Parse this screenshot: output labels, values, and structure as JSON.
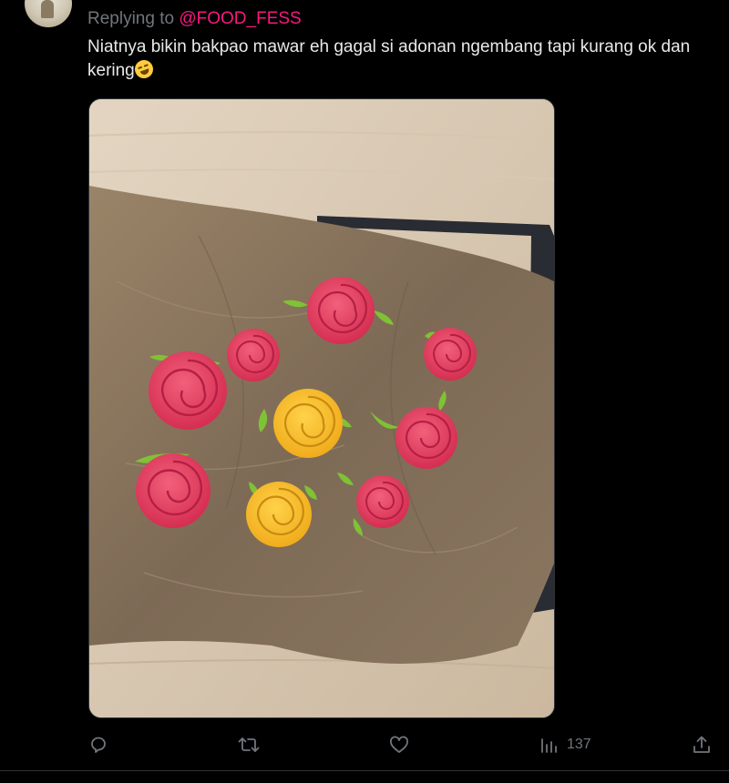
{
  "reply": {
    "prefix": "Replying to ",
    "handle": "@FOOD_FESS"
  },
  "tweet": {
    "text": "Niatnya bikin bakpao mawar eh gagal si adonan ngembang tapi kurang ok dan kering",
    "emoji": "rolling-on-floor-laughing-emoji"
  },
  "actions": {
    "reply_icon": "reply-icon",
    "retweet_icon": "retweet-icon",
    "like_icon": "like-icon",
    "views_icon": "views-icon",
    "views_count": "137",
    "share_icon": "share-icon"
  },
  "colors": {
    "background": "#000000",
    "text": "#e7e9ea",
    "muted": "#71767b",
    "mention": "#f91880"
  }
}
